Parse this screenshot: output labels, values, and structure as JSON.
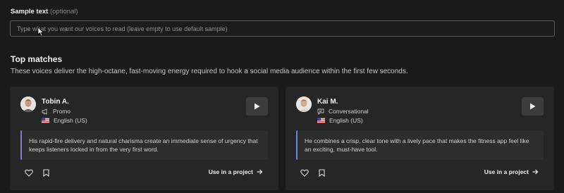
{
  "sample": {
    "label": "Sample text",
    "optional": "(optional)",
    "placeholder": "Type what you want our voices to read (leave empty to use default sample)"
  },
  "matches": {
    "title": "Top matches",
    "subtitle": "These voices deliver the high-octane, fast-moving energy required to hook a social media audience within the first few seconds."
  },
  "voices": [
    {
      "name": "Tobin A.",
      "style": "Promo",
      "style_icon": "megaphone-icon",
      "language": "English (US)",
      "description": "His rapid-fire delivery and natural charisma create an immediate sense of urgency that keeps listeners locked in from the very first word.",
      "accent": "#8a7bd6",
      "action": "Use in a project"
    },
    {
      "name": "Kai M.",
      "style": "Conversational",
      "style_icon": "chat-icon",
      "language": "English (US)",
      "description": "He combines a crisp, clear tone with a lively pace that makes the fitness app feel like an exciting, must-have tool.",
      "accent": "#6f86c8",
      "action": "Use in a project"
    }
  ]
}
